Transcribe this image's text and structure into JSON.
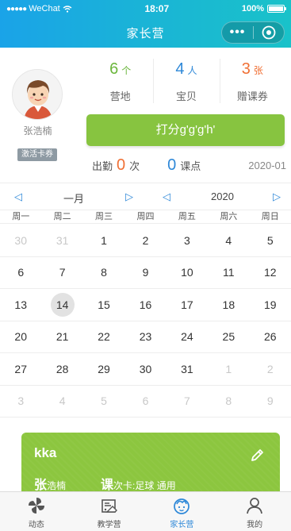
{
  "status_bar": {
    "carrier": "WeChat",
    "signal_dots": "●●●●●",
    "time": "18:07",
    "battery": "100%"
  },
  "navbar": {
    "title": "家长营",
    "more_glyph": "•••"
  },
  "profile": {
    "name": "张浩楠",
    "badge": "激活卡券"
  },
  "stats": [
    {
      "value": "6",
      "unit": "个",
      "label": "营地",
      "color": "#6bb63c"
    },
    {
      "value": "4",
      "unit": "人",
      "label": "宝贝",
      "color": "#2e88d8"
    },
    {
      "value": "3",
      "unit": "张",
      "label": "赠课券",
      "color": "#f07035"
    }
  ],
  "score_button": "打分g'g'g'h'",
  "attendance": {
    "label": "出勤",
    "count": "0",
    "count_unit": "次",
    "points": "0",
    "points_unit": "课点",
    "month": "2020-01"
  },
  "calendar": {
    "prev_arrow": "◁",
    "next_arrow": "▷",
    "month": "一月",
    "year": "2020",
    "weekdays": [
      "周一",
      "周二",
      "周三",
      "周四",
      "周五",
      "周六",
      "周日"
    ],
    "weeks": [
      [
        {
          "d": "30",
          "dim": true
        },
        {
          "d": "31",
          "dim": true
        },
        {
          "d": "1"
        },
        {
          "d": "2"
        },
        {
          "d": "3"
        },
        {
          "d": "4"
        },
        {
          "d": "5"
        }
      ],
      [
        {
          "d": "6"
        },
        {
          "d": "7"
        },
        {
          "d": "8"
        },
        {
          "d": "9"
        },
        {
          "d": "10"
        },
        {
          "d": "11"
        },
        {
          "d": "12"
        }
      ],
      [
        {
          "d": "13"
        },
        {
          "d": "14",
          "today": true
        },
        {
          "d": "15"
        },
        {
          "d": "16"
        },
        {
          "d": "17"
        },
        {
          "d": "18"
        },
        {
          "d": "19"
        }
      ],
      [
        {
          "d": "20"
        },
        {
          "d": "21"
        },
        {
          "d": "22"
        },
        {
          "d": "23"
        },
        {
          "d": "24"
        },
        {
          "d": "25"
        },
        {
          "d": "26"
        }
      ],
      [
        {
          "d": "27"
        },
        {
          "d": "28"
        },
        {
          "d": "29"
        },
        {
          "d": "30"
        },
        {
          "d": "31"
        },
        {
          "d": "1",
          "dim": true
        },
        {
          "d": "2",
          "dim": true
        }
      ],
      [
        {
          "d": "3",
          "dim": true
        },
        {
          "d": "4",
          "dim": true
        },
        {
          "d": "5",
          "dim": true
        },
        {
          "d": "6",
          "dim": true
        },
        {
          "d": "7",
          "dim": true
        },
        {
          "d": "8",
          "dim": true
        },
        {
          "d": "9",
          "dim": true
        }
      ]
    ]
  },
  "course_card": {
    "name": "kka",
    "student_initial": "张",
    "student_rest": "浩楠",
    "course_initial": "课",
    "course_rest": "次卡:足球 通用",
    "color": "#8cc63f"
  },
  "tabbar": {
    "active_color": "#2e88d8",
    "tabs": [
      {
        "label": "动态",
        "icon": "pinwheel-icon"
      },
      {
        "label": "教学营",
        "icon": "teaching-camp-icon"
      },
      {
        "label": "家长营",
        "icon": "parent-face-icon",
        "active": true
      },
      {
        "label": "我的",
        "icon": "person-icon"
      }
    ]
  }
}
